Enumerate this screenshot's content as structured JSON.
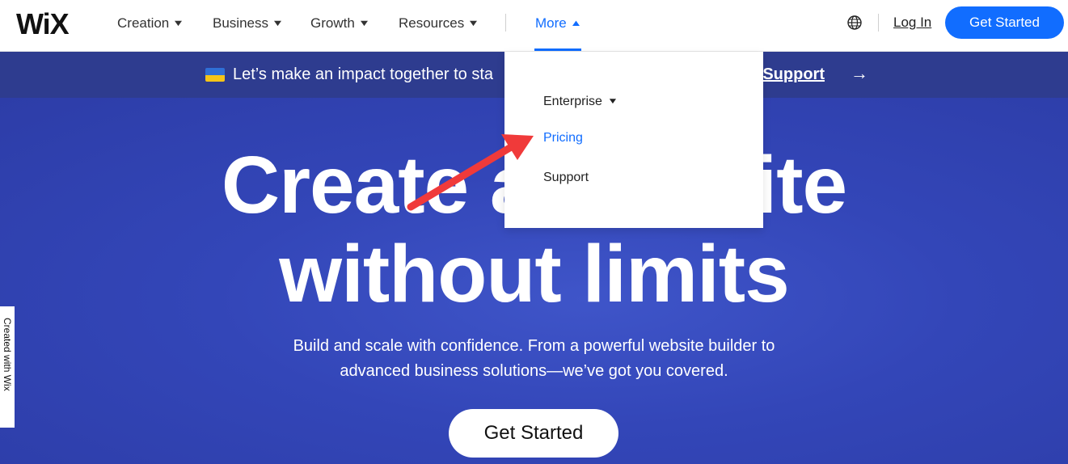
{
  "header": {
    "logo": "WiX",
    "nav": [
      {
        "label": "Creation",
        "chevron": "▼"
      },
      {
        "label": "Business",
        "chevron": "▼"
      },
      {
        "label": "Growth",
        "chevron": "▼"
      },
      {
        "label": "Resources",
        "chevron": "▼"
      },
      {
        "label": "More",
        "chevron": "▲"
      }
    ],
    "login": "Log In",
    "cta": "Get Started"
  },
  "banner": {
    "text": "Let’s make an impact together to sta",
    "link": "ow Support",
    "arrow": "→"
  },
  "dropdown": {
    "items": [
      {
        "label": "Enterprise",
        "chevron": "▼"
      },
      {
        "label": "Pricing"
      },
      {
        "label": "Support"
      }
    ]
  },
  "hero": {
    "line1": "Create a website",
    "line2": "without limits",
    "sub_line1": "Build and scale with confidence. From a powerful website builder to",
    "sub_line2": "advanced business solutions—we’ve got you covered.",
    "cta": "Get Started",
    "side_tab": "Created with Wix"
  },
  "colors": {
    "accent": "#116dff",
    "banner": "#2e3c8f",
    "hero": "#3346b8",
    "annotation_arrow": "#f03a3a"
  },
  "icons": [
    "globe-icon",
    "chevron-down-icon",
    "chevron-up-icon",
    "arrow-right-icon",
    "ukraine-flag-icon"
  ]
}
